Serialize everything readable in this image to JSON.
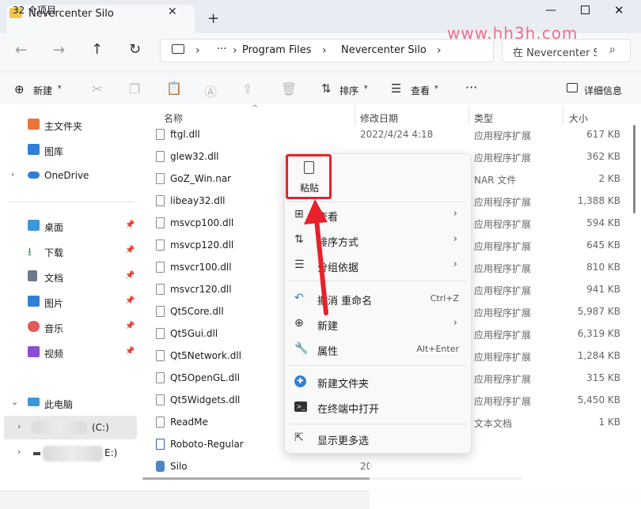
{
  "window": {
    "tab_title": "Nevercenter Silo",
    "close": "✕",
    "new_tab": "+",
    "min": "—",
    "close_window": "✕"
  },
  "nav": {
    "back": "←",
    "forward": "→",
    "up": "↑",
    "refresh": "↻",
    "more": "···",
    "sep": "›",
    "breadcrumbs": [
      "Program Files",
      "Nevercenter Silo"
    ],
    "search_placeholder": "在 Nevercenter Silo 中搜索"
  },
  "watermark": "www.hh3h.com",
  "toolbar": {
    "new_label": "新建",
    "sort_label": "排序",
    "view_label": "查看",
    "more": "···",
    "details_label": "详细信息"
  },
  "sidebar": {
    "items": [
      {
        "label": "主文件夹",
        "color": "#e6763a"
      },
      {
        "label": "图库",
        "color": "#2f7fd8"
      },
      {
        "label": "OneDrive",
        "color": "#2f7fd8"
      },
      {
        "label": "桌面",
        "color": "#3a9ad9"
      },
      {
        "label": "下载",
        "color": "#2a9c58"
      },
      {
        "label": "文档",
        "color": "#6b7a8f"
      },
      {
        "label": "图片",
        "color": "#2f7fd8"
      },
      {
        "label": "音乐",
        "color": "#e25a5a"
      },
      {
        "label": "视频",
        "color": "#8a4fd3"
      },
      {
        "label": "此电脑",
        "color": "#3a9ad9"
      },
      {
        "label": "(C:)",
        "color": "#888"
      },
      {
        "label": "E:)",
        "color": "#888"
      }
    ]
  },
  "columns": {
    "name": "名称",
    "date": "修改日期",
    "type": "类型",
    "size": "大小"
  },
  "files": [
    {
      "name": "ftgl.dll",
      "date": "2022/4/24 4:18",
      "type": "应用程序扩展",
      "size": "617 KB"
    },
    {
      "name": "glew32.dll",
      "date": "",
      "type": "应用程序扩展",
      "size": "362 KB"
    },
    {
      "name": "GoZ_Win.nar",
      "date": "",
      "type": "NAR 文件",
      "size": "2 KB"
    },
    {
      "name": "libeay32.dll",
      "date": "",
      "type": "应用程序扩展",
      "size": "1,388 KB"
    },
    {
      "name": "msvcp100.dll",
      "date": "",
      "type": "应用程序扩展",
      "size": "594 KB"
    },
    {
      "name": "msvcp120.dll",
      "date": "",
      "type": "应用程序扩展",
      "size": "645 KB"
    },
    {
      "name": "msvcr100.dll",
      "date": "",
      "type": "应用程序扩展",
      "size": "810 KB"
    },
    {
      "name": "msvcr120.dll",
      "date": "",
      "type": "应用程序扩展",
      "size": "941 KB"
    },
    {
      "name": "Qt5Core.dll",
      "date": "",
      "type": "应用程序扩展",
      "size": "5,987 KB"
    },
    {
      "name": "Qt5Gui.dll",
      "date": "",
      "type": "应用程序扩展",
      "size": "6,319 KB"
    },
    {
      "name": "Qt5Network.dll",
      "date": "",
      "type": "应用程序扩展",
      "size": "1,284 KB"
    },
    {
      "name": "Qt5OpenGL.dll",
      "date": "",
      "type": "应用程序扩展",
      "size": "315 KB"
    },
    {
      "name": "Qt5Widgets.dll",
      "date": "",
      "type": "应用程序扩展",
      "size": "5,450 KB"
    },
    {
      "name": "ReadMe",
      "date": "",
      "type": "文本文档",
      "size": "1 KB"
    },
    {
      "name": "Roboto-Regular",
      "date": "",
      "type": "",
      "size": ""
    },
    {
      "name": "Silo",
      "date": "20",
      "type": "",
      "size": ""
    }
  ],
  "status": {
    "count": "32 个项目"
  },
  "context_menu": {
    "paste": "粘贴",
    "items": [
      {
        "label": "查看",
        "icon": "⊞",
        "key": "",
        "chevron": "›"
      },
      {
        "label": "排序方式",
        "icon": "⇅",
        "key": "",
        "chevron": "›"
      },
      {
        "label": "分组依据",
        "icon": "☰",
        "key": "",
        "chevron": "›"
      },
      {
        "label": "撤消 重命名",
        "icon": "↶",
        "key": "Ctrl+Z",
        "chevron": ""
      },
      {
        "label": "新建",
        "icon": "⊕",
        "key": "",
        "chevron": "›"
      },
      {
        "label": "属性",
        "icon": "🔧",
        "key": "Alt+Enter",
        "chevron": ""
      },
      {
        "label": "新建文件夹",
        "icon": "✚",
        "key": "",
        "chevron": ""
      },
      {
        "label": "在终端中打开",
        "icon": ">_",
        "key": "",
        "chevron": ""
      },
      {
        "label": "显示更多选",
        "icon": "⇱",
        "key": "",
        "chevron": ""
      }
    ]
  },
  "colors": {
    "accent": "#0067c0",
    "highlight_red": "#e8212b"
  }
}
